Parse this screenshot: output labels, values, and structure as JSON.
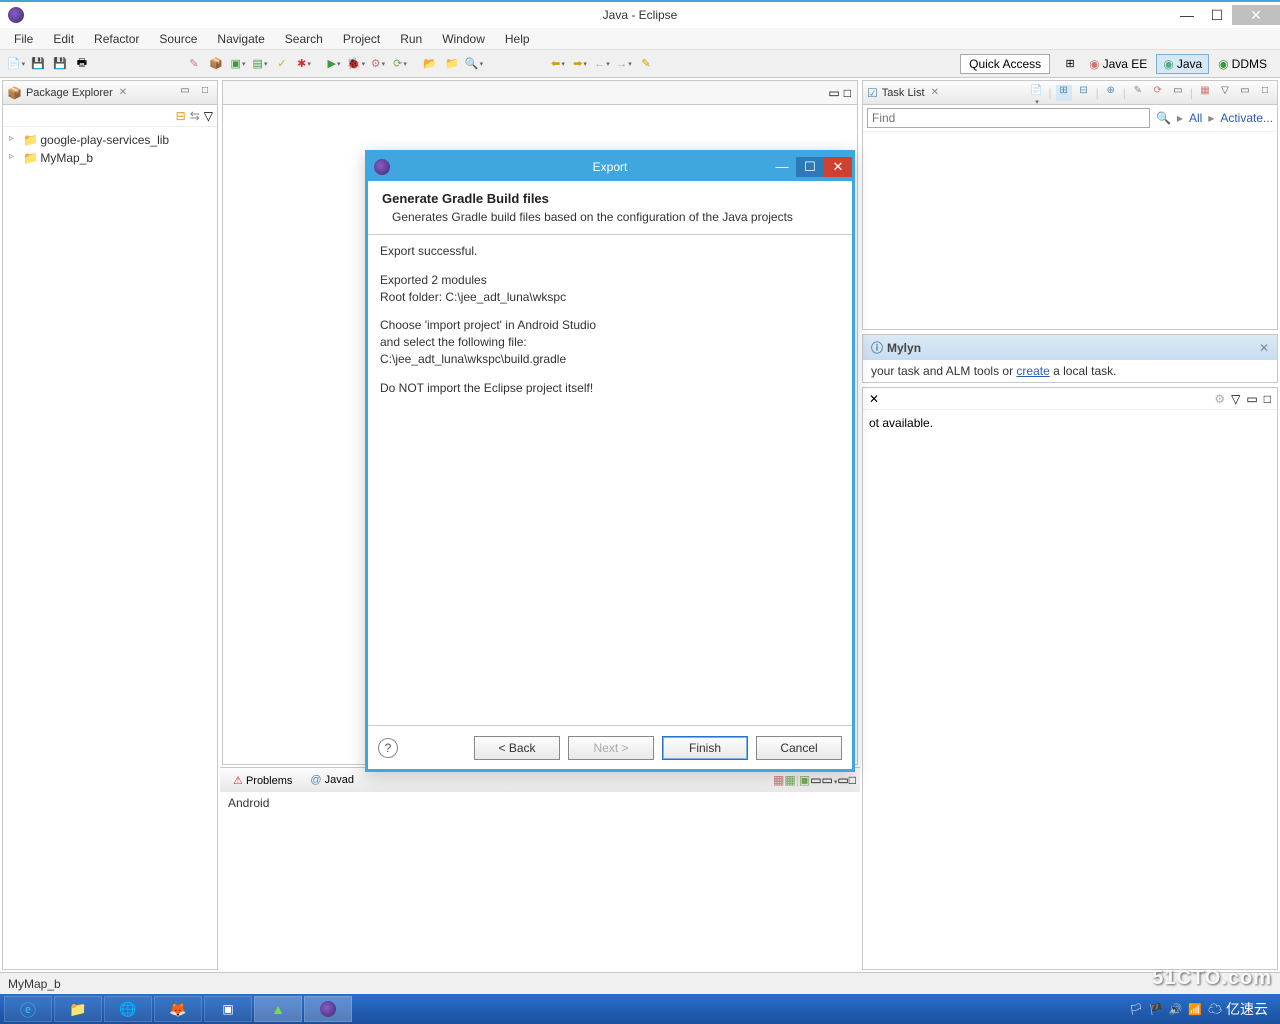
{
  "window": {
    "title": "Java - Eclipse"
  },
  "menu": [
    "File",
    "Edit",
    "Refactor",
    "Source",
    "Navigate",
    "Search",
    "Project",
    "Run",
    "Window",
    "Help"
  ],
  "toolbar": {
    "quick_access": "Quick Access"
  },
  "perspectives": [
    {
      "label": "Java EE",
      "active": false
    },
    {
      "label": "Java",
      "active": true
    },
    {
      "label": "DDMS",
      "active": false
    }
  ],
  "package_explorer": {
    "title": "Package Explorer",
    "items": [
      "google-play-services_lib",
      "MyMap_b"
    ]
  },
  "task_list": {
    "title": "Task List",
    "find_placeholder": "Find",
    "all": "All",
    "activate": "Activate..."
  },
  "mylyn": {
    "title": "Mylyn",
    "text_prefix": "your task and ALM tools or ",
    "link": "create",
    "text_suffix": " a local task."
  },
  "outline": {
    "not_available": "ot available."
  },
  "bottom": {
    "tabs": [
      "Problems",
      "Javad"
    ],
    "body": "Android"
  },
  "status": {
    "text": "MyMap_b"
  },
  "dialog": {
    "title": "Export",
    "heading": "Generate Gradle Build files",
    "sub": "Generates Gradle build files based on the configuration of the Java projects",
    "body1": "Export successful.",
    "body2": "Exported 2 modules\nRoot folder: C:\\jee_adt_luna\\wkspc",
    "body3": "Choose 'import project' in Android Studio\nand select the following file:\n    C:\\jee_adt_luna\\wkspc\\build.gradle",
    "body4": "Do NOT import the Eclipse project itself!",
    "back": "< Back",
    "next": "Next >",
    "finish": "Finish",
    "cancel": "Cancel"
  },
  "watermark": "51CTO.com"
}
